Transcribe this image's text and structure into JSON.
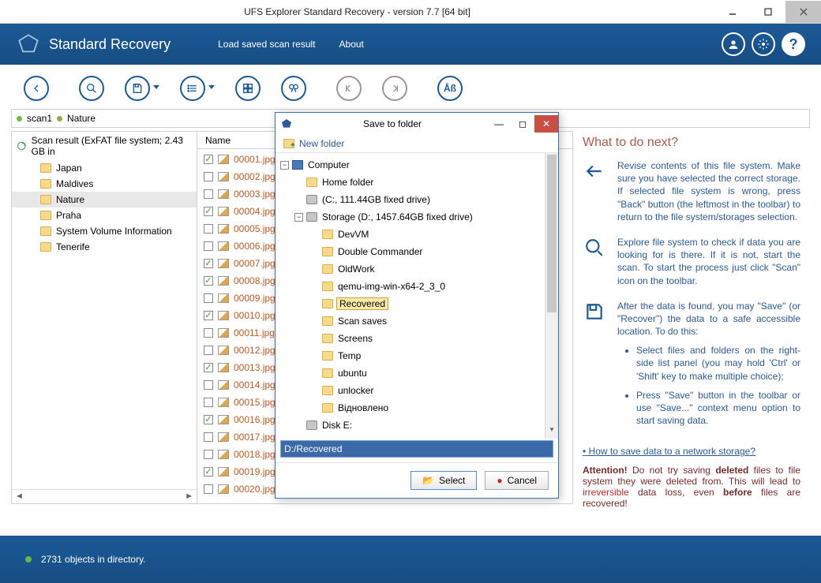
{
  "titlebar": {
    "title": "UFS Explorer Standard Recovery - version 7.7 [64 bit]"
  },
  "header": {
    "app_title": "Standard Recovery",
    "menu": {
      "load": "Load saved scan result",
      "about": "About"
    }
  },
  "breadcrumb": {
    "item1": "scan1",
    "item2": "Nature"
  },
  "scan_head": "Scan result (ExFAT file system; 2.43 GB in",
  "tree": {
    "items": [
      {
        "label": "Japan"
      },
      {
        "label": "Maldives"
      },
      {
        "label": "Nature"
      },
      {
        "label": "Praha"
      },
      {
        "label": "System Volume Information"
      },
      {
        "label": "Tenerife"
      }
    ]
  },
  "filelist": {
    "header": "Name",
    "rows": [
      {
        "checked": true,
        "name": "00001.jpg"
      },
      {
        "checked": false,
        "name": "00002.jpg"
      },
      {
        "checked": false,
        "name": "00003.jpg"
      },
      {
        "checked": true,
        "name": "00004.jpg"
      },
      {
        "checked": false,
        "name": "00005.jpg"
      },
      {
        "checked": false,
        "name": "00006.jpg"
      },
      {
        "checked": true,
        "name": "00007.jpg"
      },
      {
        "checked": true,
        "name": "00008.jpg"
      },
      {
        "checked": false,
        "name": "00009.jpg"
      },
      {
        "checked": true,
        "name": "00010.jpg"
      },
      {
        "checked": false,
        "name": "00011.jpg"
      },
      {
        "checked": false,
        "name": "00012.jpg"
      },
      {
        "checked": true,
        "name": "00013.jpg"
      },
      {
        "checked": false,
        "name": "00014.jpg"
      },
      {
        "checked": false,
        "name": "00015.jpg"
      },
      {
        "checked": true,
        "name": "00016.jpg"
      },
      {
        "checked": false,
        "name": "00017.jpg"
      },
      {
        "checked": false,
        "name": "00018.jpg"
      },
      {
        "checked": true,
        "name": "00019.jpg"
      },
      {
        "checked": false,
        "name": "00020.jpg"
      }
    ]
  },
  "dialog": {
    "title": "Save to folder",
    "new_folder": "New folder",
    "path": "D:/Recovered",
    "select": "Select",
    "cancel": "Cancel",
    "tree": {
      "computer": "Computer",
      "home": "Home folder",
      "c_drive": "(C:, 111.44GB fixed drive)",
      "d_drive": "Storage (D:, 1457.64GB fixed drive)",
      "folders": [
        "DevVM",
        "Double Commander",
        "OldWork",
        "qemu-img-win-x64-2_3_0",
        "Recovered",
        "Scan saves",
        "Screens",
        "Temp",
        "ubuntu",
        "unlocker",
        "Відновлено"
      ],
      "e_drive": "Disk E:"
    }
  },
  "right": {
    "title": "What to do next?",
    "p1": "Revise contents of this file system. Make sure you have selected the correct storage. If selected file system is wrong, press \"Back\" button (the leftmost in the toolbar) to return to the file system/storages selection.",
    "p2": "Explore file system to check if data you are looking for is there. If it is not, start the scan. To start the process just click \"Scan\" icon on the toolbar.",
    "p3_head": "After the data is found, you may \"Save\" (or \"Recover\") the data to a safe accessible location. To do this:",
    "li1": "Select files and folders on the right-side list panel (you may hold 'Ctrl' or 'Shift' key to make multiple choice);",
    "li2": "Press \"Save\" button in the toolbar or use \"Save...\" context menu option to start saving data.",
    "link": "How to save data to a network storage?",
    "warn_pre": "Attention!",
    "warn_1": " Do not try saving ",
    "warn_del": "deleted",
    "warn_2": " files to file system they were deleted from. This will lead to ",
    "warn_irr": "irreversible",
    "warn_3": " data loss, even ",
    "warn_bef": "before",
    "warn_4": " files are recovered!"
  },
  "footer": {
    "status": "2731 objects in directory."
  }
}
